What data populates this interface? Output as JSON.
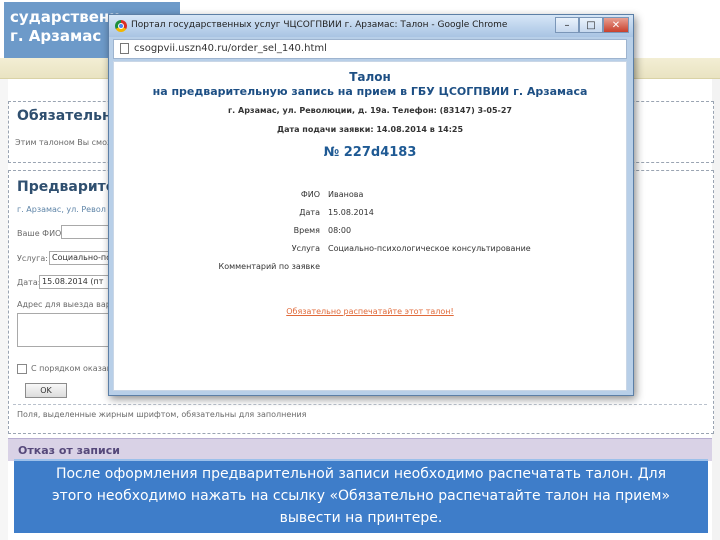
{
  "background_page": {
    "site_title_line1": "сударственн",
    "site_title_line2": "г. Арзамас",
    "panel1": {
      "title": "Обязательно",
      "text": "Этим талоном Вы смож"
    },
    "panel2": {
      "title": "Предварител",
      "address": "г. Арзамас, ул. Револ",
      "fio_label": "Ваше ФИО:",
      "service_label": "Услуга:",
      "service_value": "Социально-пс",
      "date_label": "Дата:",
      "date_value": "15.08.2014 (пт",
      "address_label": "Адрес для выезда варн",
      "consent_text": "С порядком оказани",
      "ok_button": "OK",
      "required_note": "Поля, выделенные жирным шрифтом, обязательны для заполнения"
    },
    "next_section": "Отказ от записи"
  },
  "browser_popup": {
    "window_title": "Портал государственных услуг ЧЦСОГПВИИ г. Арзамас: Талон - Google Chrome",
    "url": "csogpvii.uszn40.ru/order_sel_140.html",
    "window_buttons": {
      "minimize": "–",
      "maximize": "□",
      "close": "✕"
    },
    "ticket": {
      "heading": "Талон",
      "subheading": "на предварительную запись на прием в ГБУ ЦСОГПВИИ г. Арзамаса",
      "address_line": "г. Арзамас, ул. Революции, д. 19а. Телефон: (83147) 3-05-27",
      "submitted_line": "Дата подачи заявки: 14.08.2014 в 14:25",
      "number": "№ 227d4183",
      "fields": [
        {
          "label": "ФИО",
          "value": "Иванова"
        },
        {
          "label": "Дата",
          "value": "15.08.2014"
        },
        {
          "label": "Время",
          "value": "08:00"
        },
        {
          "label": "Услуга",
          "value": "Социально-психологическое консультирование"
        },
        {
          "label": "Комментарий по заявке",
          "value": ""
        }
      ],
      "print_link": "Обязательно распечатайте этот талон!"
    }
  },
  "caption": {
    "line1": "После оформления предварительной записи необходимо распечатать талон. Для",
    "line2": "этого необходимо нажать на ссылку «Обязательно распечатайте талон на прием»",
    "line3": "вывести на принтере."
  },
  "colors": {
    "brand_blue": "#6d9ac9",
    "ticket_heading": "#1d4f84",
    "print_link": "#e06a3a",
    "caption_bg": "#3e7dc9"
  }
}
